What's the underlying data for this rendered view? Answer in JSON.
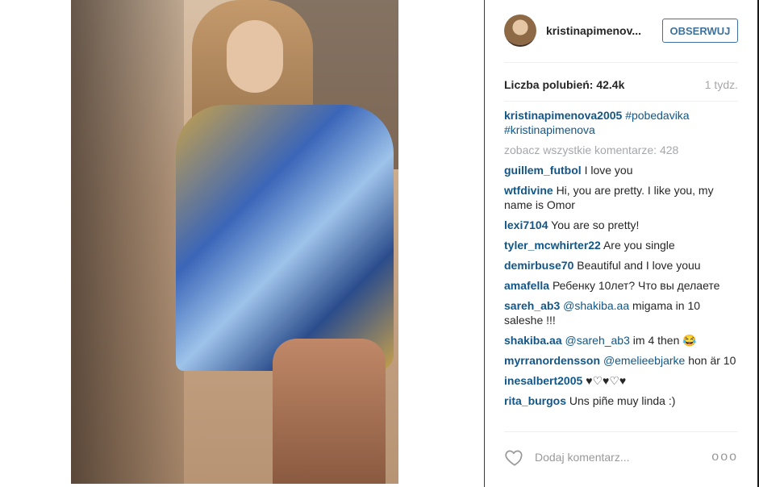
{
  "post": {
    "username": "kristinapimenov...",
    "follow_label": "OBSERWUJ",
    "likes_label": "Liczba polubień: 42.4k",
    "time_label": "1 tydz.",
    "caption_user": "kristinapimenova2005",
    "caption_tags": "#pobedavika #kristinapimenova",
    "view_all": "zobacz wszystkie komentarze: 428",
    "comments": [
      {
        "user": "guillem_futbol",
        "text": "I love you"
      },
      {
        "user": "wtfdivine",
        "text": "Hi, you are pretty. I like you, my name is Omor"
      },
      {
        "user": "lexi7104",
        "text": "You are so pretty!"
      },
      {
        "user": "tyler_mcwhirter22",
        "text": "Are you single"
      },
      {
        "user": "demirbuse70",
        "text": "Beautiful and I love youu"
      },
      {
        "user": "amafella",
        "text": "Ребенку 10лет? Что вы делаете"
      },
      {
        "user": "sareh_ab3",
        "mention": "@shakiba.aa",
        "text": "migama in 10 saleshe !!!"
      },
      {
        "user": "shakiba.aa",
        "mention": "@sareh_ab3",
        "text": "im 4 then 😂"
      },
      {
        "user": "myrranordensson",
        "mention": "@emelieebjarke",
        "text": "hon är 10"
      },
      {
        "user": "inesalbert2005",
        "text": "♥♡♥♡♥"
      },
      {
        "user": "rita_burgos",
        "text": "Uns piñe muy linda :)"
      }
    ],
    "add_comment_placeholder": "Dodaj komentarz...",
    "more_label": "ooo"
  },
  "icons": {
    "heart": "heart-icon",
    "more": "more-options-icon"
  },
  "colors": {
    "link": "#125688",
    "follow": "#3f729b",
    "muted": "#a5a7aa"
  }
}
